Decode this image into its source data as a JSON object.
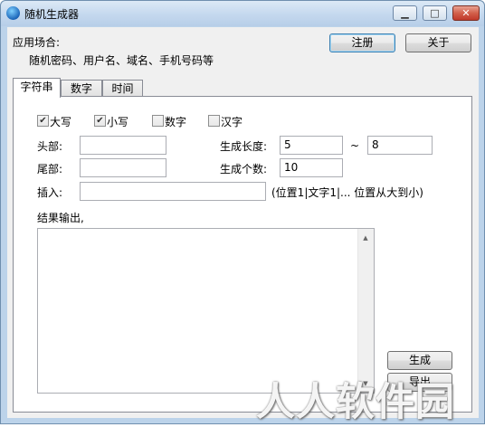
{
  "window": {
    "title": "随机生成器",
    "icon": "app-globe-icon"
  },
  "header": {
    "usage_label": "应用场合:",
    "usage_text": "随机密码、用户名、域名、手机号码等",
    "register_button": "注册",
    "about_button": "关于"
  },
  "tabs": [
    {
      "label": "字符串",
      "active": true
    },
    {
      "label": "数字",
      "active": false
    },
    {
      "label": "时间",
      "active": false
    }
  ],
  "options": {
    "uppercase": {
      "label": "大写",
      "checked": true
    },
    "lowercase": {
      "label": "小写",
      "checked": true
    },
    "digits": {
      "label": "数字",
      "checked": false
    },
    "chinese": {
      "label": "汉字",
      "checked": false
    }
  },
  "form": {
    "head_label": "头部:",
    "head_value": "",
    "tail_label": "尾部:",
    "tail_value": "",
    "insert_label": "插入:",
    "insert_value": "",
    "insert_hint": "(位置1|文字1|... 位置从大到小)",
    "length_label": "生成长度:",
    "length_min": "5",
    "length_sep": "~",
    "length_max": "8",
    "count_label": "生成个数:",
    "count_value": "10"
  },
  "output": {
    "label": "结果输出,",
    "value": ""
  },
  "actions": {
    "generate_button": "生成",
    "second_button": "导出"
  },
  "watermark": "人人软件园"
}
